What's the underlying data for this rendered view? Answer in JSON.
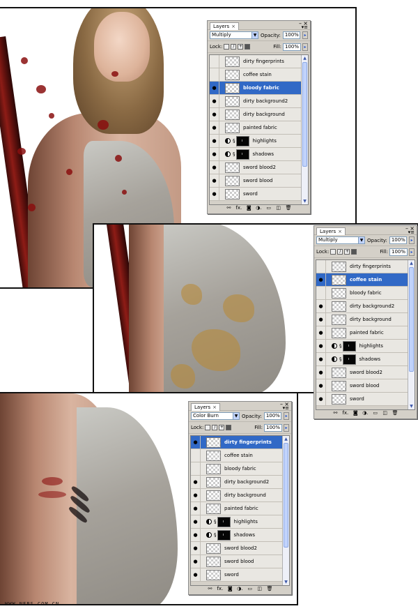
{
  "panels": [
    {
      "tab_label": "Layers",
      "tab_close": "×",
      "minimize": "–",
      "close": "×",
      "menu": "▾≡",
      "blend_mode": "Multiply",
      "opacity_label": "Opacity:",
      "opacity_value": "100%",
      "lock_label": "Lock:",
      "fill_label": "Fill:",
      "fill_value": "100%",
      "footer_icons": [
        "link-icon",
        "fx-icon",
        "mask-icon",
        "adjustment-icon",
        "folder-icon",
        "new-layer-icon",
        "trash-icon"
      ],
      "footer_glyphs": [
        "⚯",
        "fx.",
        "◙",
        "◑.",
        "▭",
        "◫",
        "🗑"
      ],
      "layers": [
        {
          "name": "dirty fingerprints",
          "visible": false,
          "selected": false,
          "type": "normal"
        },
        {
          "name": "coffee stain",
          "visible": false,
          "selected": false,
          "type": "normal"
        },
        {
          "name": "bloody fabric",
          "visible": true,
          "selected": true,
          "type": "normal"
        },
        {
          "name": "dirty background2",
          "visible": true,
          "selected": false,
          "type": "normal"
        },
        {
          "name": "dirty background",
          "visible": true,
          "selected": false,
          "type": "normal"
        },
        {
          "name": "painted fabric",
          "visible": true,
          "selected": false,
          "type": "normal"
        },
        {
          "name": "highlights",
          "visible": true,
          "selected": false,
          "type": "adjustment"
        },
        {
          "name": "shadows",
          "visible": true,
          "selected": false,
          "type": "adjustment"
        },
        {
          "name": "sword blood2",
          "visible": true,
          "selected": false,
          "type": "normal"
        },
        {
          "name": "sword blood",
          "visible": true,
          "selected": false,
          "type": "normal"
        },
        {
          "name": "sword",
          "visible": true,
          "selected": false,
          "type": "normal"
        }
      ]
    },
    {
      "tab_label": "Layers",
      "tab_close": "×",
      "minimize": "–",
      "close": "×",
      "menu": "▾≡",
      "blend_mode": "Multiply",
      "opacity_label": "Opacity:",
      "opacity_value": "100%",
      "lock_label": "Lock:",
      "fill_label": "Fill:",
      "fill_value": "100%",
      "footer_icons": [
        "link-icon",
        "fx-icon",
        "mask-icon",
        "adjustment-icon",
        "folder-icon",
        "new-layer-icon",
        "trash-icon"
      ],
      "footer_glyphs": [
        "⚯",
        "fx.",
        "◙",
        "◑.",
        "▭",
        "◫",
        "🗑"
      ],
      "layers": [
        {
          "name": "dirty fingerprints",
          "visible": false,
          "selected": false,
          "type": "normal"
        },
        {
          "name": "coffee stain",
          "visible": true,
          "selected": true,
          "type": "normal"
        },
        {
          "name": "bloody fabric",
          "visible": false,
          "selected": false,
          "type": "normal"
        },
        {
          "name": "dirty background2",
          "visible": true,
          "selected": false,
          "type": "normal"
        },
        {
          "name": "dirty background",
          "visible": true,
          "selected": false,
          "type": "normal"
        },
        {
          "name": "painted fabric",
          "visible": true,
          "selected": false,
          "type": "normal"
        },
        {
          "name": "highlights",
          "visible": true,
          "selected": false,
          "type": "adjustment"
        },
        {
          "name": "shadows",
          "visible": true,
          "selected": false,
          "type": "adjustment"
        },
        {
          "name": "sword blood2",
          "visible": true,
          "selected": false,
          "type": "normal"
        },
        {
          "name": "sword blood",
          "visible": true,
          "selected": false,
          "type": "normal"
        },
        {
          "name": "sword",
          "visible": true,
          "selected": false,
          "type": "normal"
        }
      ]
    },
    {
      "tab_label": "Layers",
      "tab_close": "×",
      "minimize": "–",
      "close": "×",
      "menu": "▾≡",
      "blend_mode": "Color Burn",
      "opacity_label": "Opacity:",
      "opacity_value": "100%",
      "lock_label": "Lock:",
      "fill_label": "Fill:",
      "fill_value": "100%",
      "footer_icons": [
        "link-icon",
        "fx-icon",
        "mask-icon",
        "adjustment-icon",
        "folder-icon",
        "new-layer-icon",
        "trash-icon"
      ],
      "footer_glyphs": [
        "⚯",
        "fx.",
        "◙",
        "◑.",
        "▭",
        "◫",
        "🗑"
      ],
      "layers": [
        {
          "name": "dirty fingerprints",
          "visible": true,
          "selected": true,
          "type": "normal"
        },
        {
          "name": "coffee stain",
          "visible": false,
          "selected": false,
          "type": "normal"
        },
        {
          "name": "bloody fabric",
          "visible": false,
          "selected": false,
          "type": "normal"
        },
        {
          "name": "dirty background2",
          "visible": true,
          "selected": false,
          "type": "normal"
        },
        {
          "name": "dirty background",
          "visible": true,
          "selected": false,
          "type": "normal"
        },
        {
          "name": "painted fabric",
          "visible": true,
          "selected": false,
          "type": "normal"
        },
        {
          "name": "highlights",
          "visible": true,
          "selected": false,
          "type": "adjustment"
        },
        {
          "name": "shadows",
          "visible": true,
          "selected": false,
          "type": "adjustment"
        },
        {
          "name": "sword blood2",
          "visible": true,
          "selected": false,
          "type": "normal"
        },
        {
          "name": "sword blood",
          "visible": true,
          "selected": false,
          "type": "normal"
        },
        {
          "name": "sword",
          "visible": true,
          "selected": false,
          "type": "normal"
        }
      ]
    }
  ],
  "watermark": "WWW.NEPS.COM.CN",
  "colors": {
    "selection": "#3169c6",
    "panel_bg": "#d4d0c8",
    "blood": "#8a0f0f",
    "coffee": "#b88a3a"
  }
}
